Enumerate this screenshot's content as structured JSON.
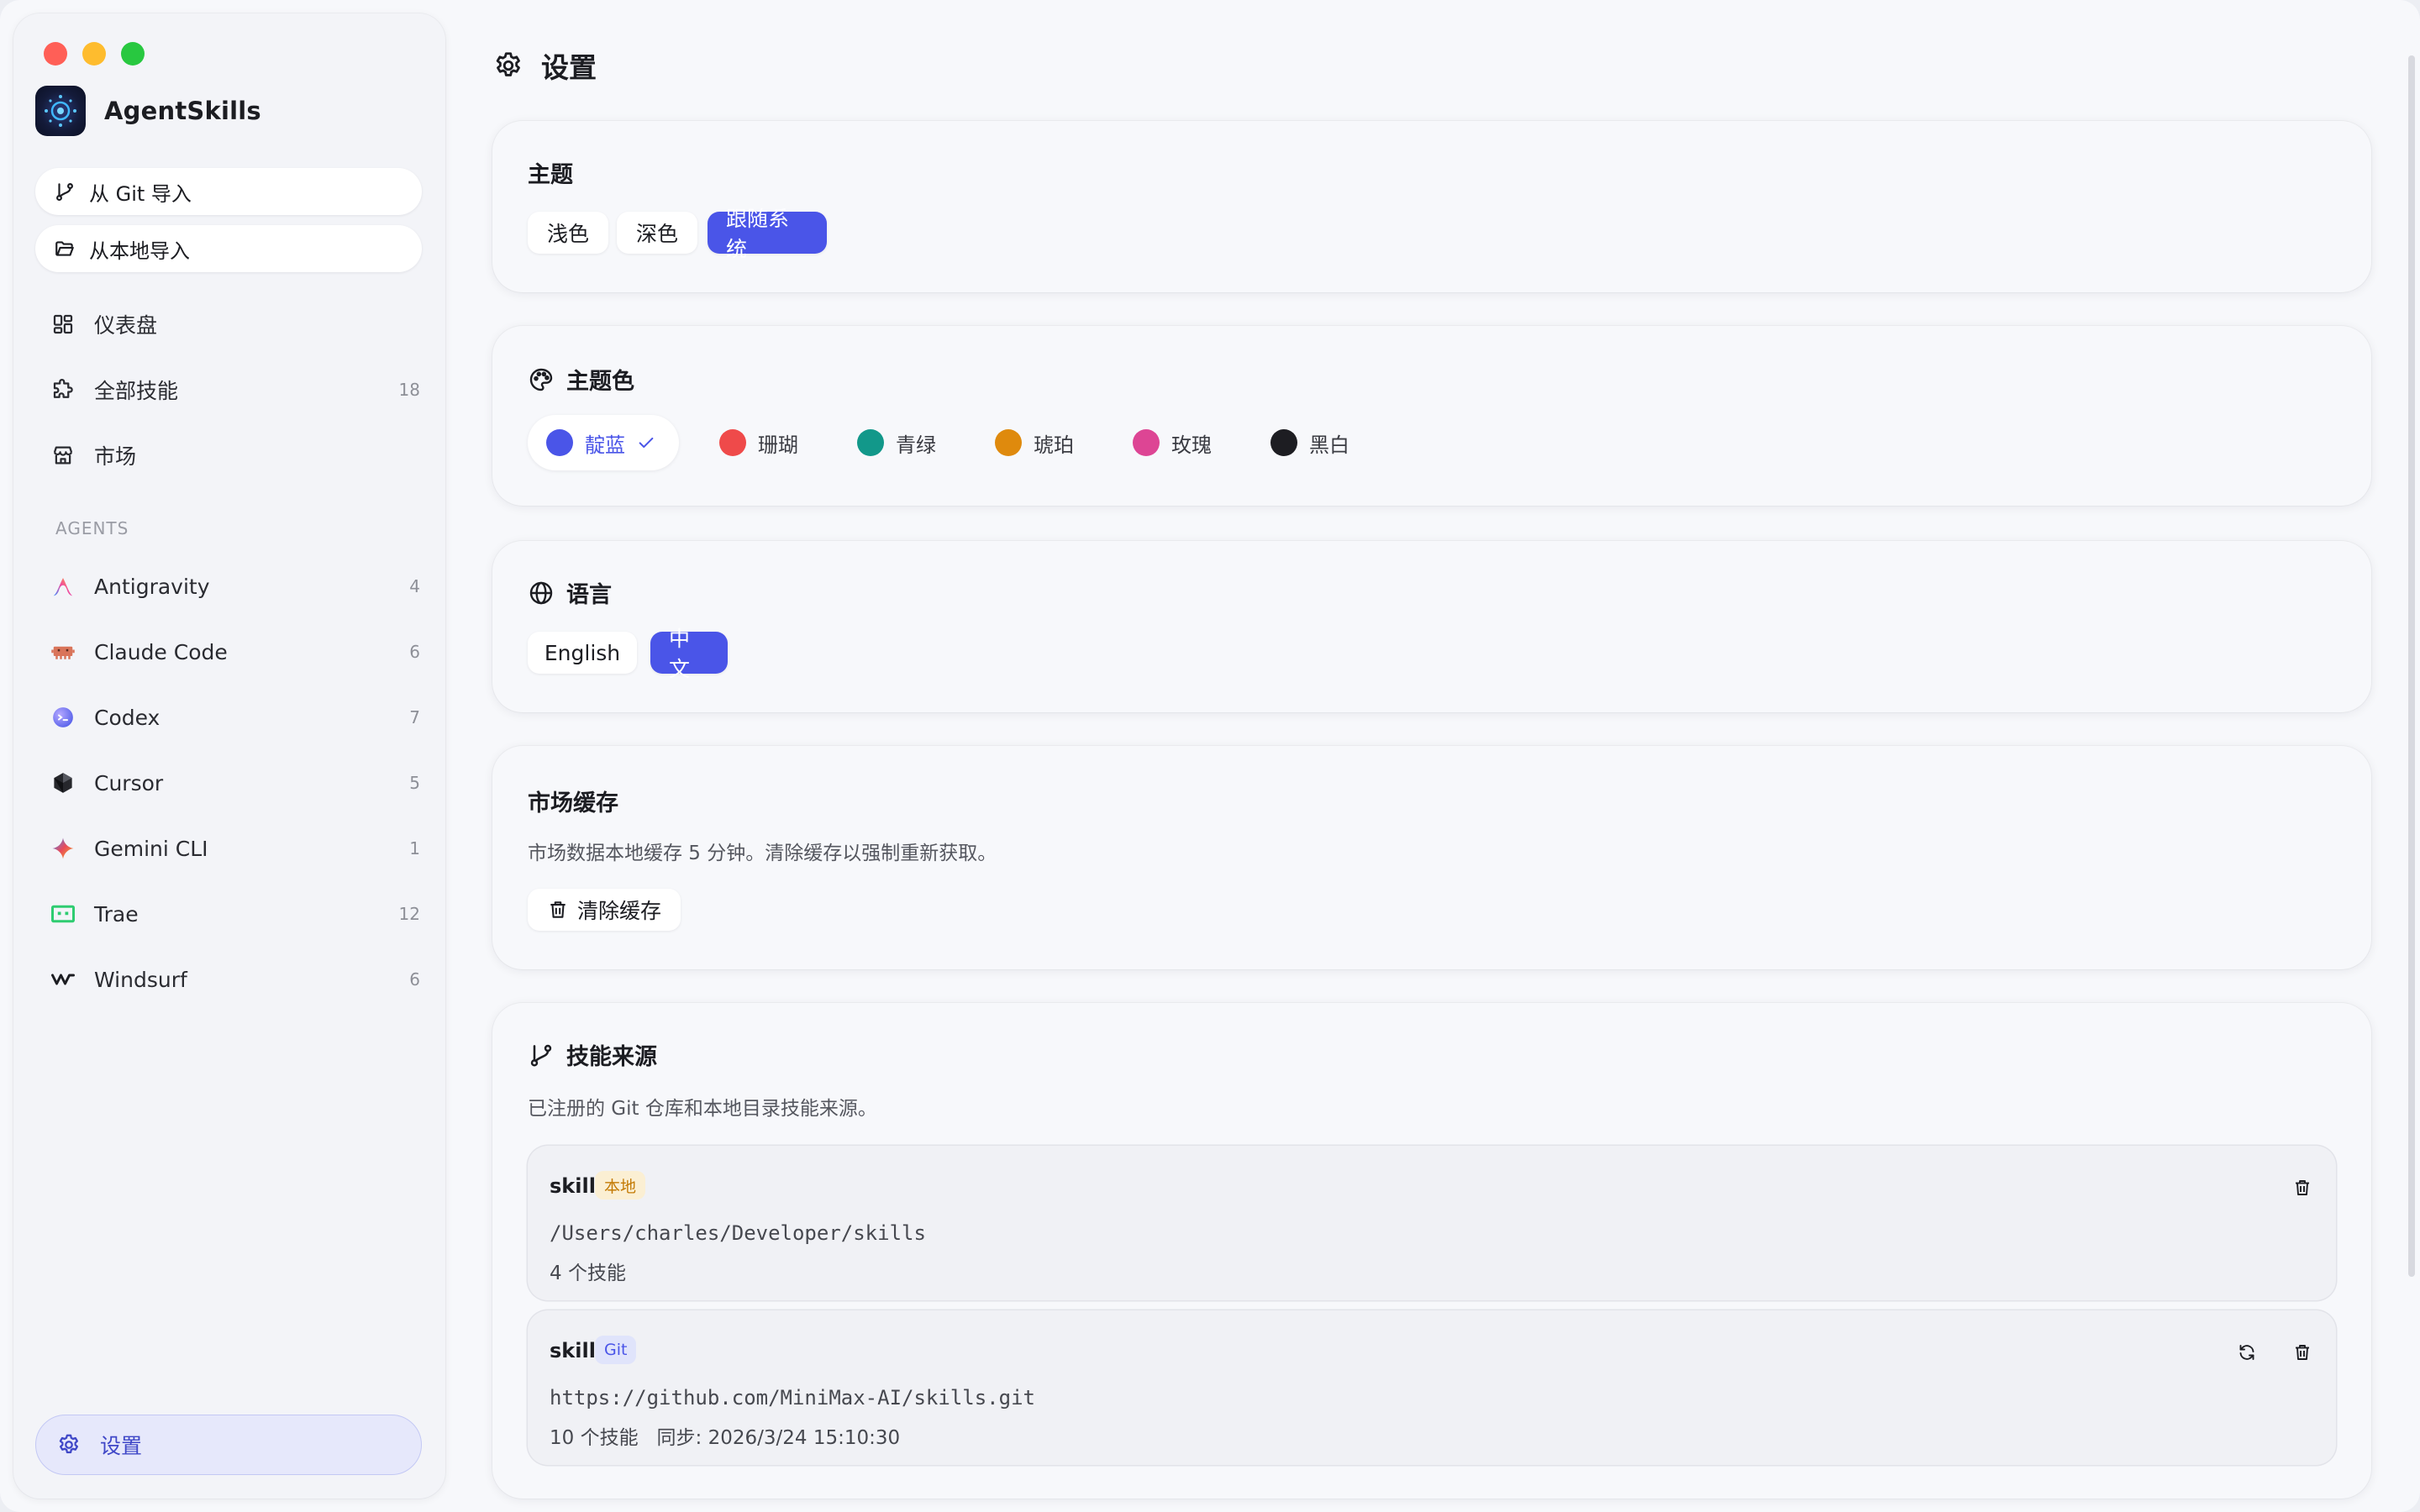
{
  "app": {
    "name": "AgentSkills"
  },
  "sidebar": {
    "import_git": "从 Git 导入",
    "import_local": "从本地导入",
    "nav": [
      {
        "label": "仪表盘",
        "icon": "dashboard-icon",
        "count": ""
      },
      {
        "label": "全部技能",
        "icon": "puzzle-icon",
        "count": "18"
      },
      {
        "label": "市场",
        "icon": "store-icon",
        "count": ""
      }
    ],
    "agents_label": "AGENTS",
    "agents": [
      {
        "label": "Antigravity",
        "icon": "antigravity-icon",
        "count": "4"
      },
      {
        "label": "Claude Code",
        "icon": "claude-code-icon",
        "count": "6"
      },
      {
        "label": "Codex",
        "icon": "codex-icon",
        "count": "7"
      },
      {
        "label": "Cursor",
        "icon": "cursor-icon",
        "count": "5"
      },
      {
        "label": "Gemini CLI",
        "icon": "gemini-icon",
        "count": "1"
      },
      {
        "label": "Trae",
        "icon": "trae-icon",
        "count": "12"
      },
      {
        "label": "Windsurf",
        "icon": "windsurf-icon",
        "count": "6"
      }
    ],
    "settings_label": "设置"
  },
  "page": {
    "title": "设置"
  },
  "theme": {
    "title": "主题",
    "options": [
      "浅色",
      "深色",
      "跟随系统"
    ],
    "selected": "跟随系统"
  },
  "accent": {
    "title": "主题色",
    "options": [
      {
        "label": "靛蓝",
        "color": "#4a55e8"
      },
      {
        "label": "珊瑚",
        "color": "#ef4a4a"
      },
      {
        "label": "青绿",
        "color": "#12988a"
      },
      {
        "label": "琥珀",
        "color": "#df8a0d"
      },
      {
        "label": "玫瑰",
        "color": "#dd4594"
      },
      {
        "label": "黑白",
        "color": "#1d1d22"
      }
    ],
    "selected": "靛蓝"
  },
  "language": {
    "title": "语言",
    "options": [
      "English",
      "中文"
    ],
    "selected": "中文"
  },
  "cache": {
    "title": "市场缓存",
    "description": "市场数据本地缓存 5 分钟。清除缓存以强制重新获取。",
    "clear_label": "清除缓存"
  },
  "sources": {
    "title": "技能来源",
    "description": "已注册的 Git 仓库和本地目录技能来源。",
    "items": [
      {
        "name": "skills",
        "badge": "本地",
        "path": "/Users/charles/Developer/skills",
        "meta": "4 个技能"
      },
      {
        "name": "skills",
        "badge": "Git",
        "path": "https://github.com/MiniMax-AI/skills.git",
        "meta": "10 个技能   同步: 2026/3/24 15:10:30"
      }
    ]
  },
  "colors": {
    "accent": "#4a55e8",
    "local_badge_bg": "#fbefd3",
    "local_badge_fg": "#c47b06",
    "git_badge_bg": "#e0e4fb"
  }
}
